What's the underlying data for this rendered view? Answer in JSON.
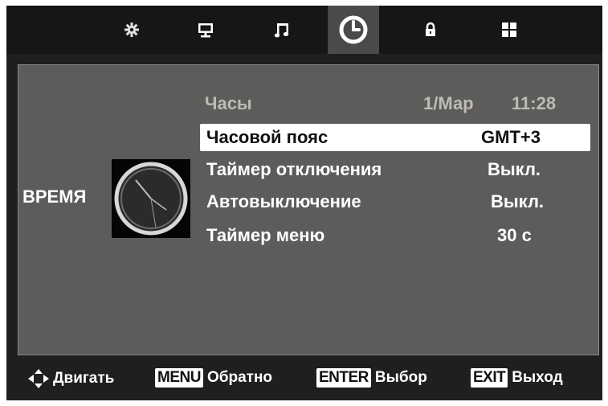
{
  "tabs": [
    {
      "icon": "settings-icon"
    },
    {
      "icon": "monitor-icon"
    },
    {
      "icon": "music-note-icon"
    },
    {
      "icon": "clock-icon",
      "active": true
    },
    {
      "icon": "lock-icon"
    },
    {
      "icon": "grid-icon"
    }
  ],
  "section": {
    "label": "ВРЕМЯ",
    "icon": "analog-clock-icon"
  },
  "clock": {
    "label": "Часы",
    "date": "1/Мар",
    "time": "11:28"
  },
  "menu": [
    {
      "label": "Часовой пояс",
      "value": "GMT+3",
      "selected": true
    },
    {
      "label": "Таймер отключения",
      "value": "Выкл."
    },
    {
      "label": "Автовыключение",
      "value": "Выкл."
    },
    {
      "label": "Таймер меню",
      "value": "30 с"
    }
  ],
  "footer": {
    "move": {
      "icon": "dpad-arrows-icon",
      "label": "Двигать"
    },
    "back": {
      "key": "MENU",
      "label": "Обратно"
    },
    "select": {
      "key": "ENTER",
      "label": "Выбор"
    },
    "exit": {
      "key": "EXIT",
      "label": "Выход"
    }
  },
  "colors": {
    "background": "#1f1f1f",
    "panel": "#5e5c5a",
    "selected": "#ffffff",
    "header_text": "#bdbbb8"
  }
}
